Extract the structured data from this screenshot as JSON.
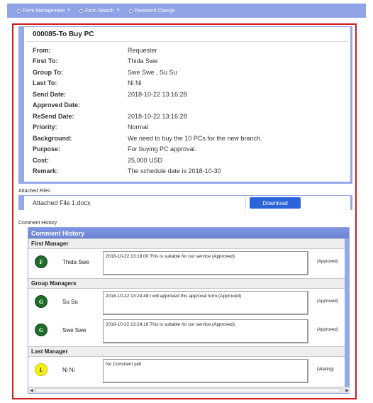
{
  "nav": {
    "items": [
      {
        "label": "Form Management",
        "has_menu": true,
        "icon": "bullet-icon"
      },
      {
        "label": "Form Search",
        "has_menu": true,
        "icon": "bullet-icon"
      },
      {
        "label": "Password Change",
        "has_menu": false,
        "icon": "bullet-icon"
      }
    ],
    "caret": "▼"
  },
  "form": {
    "title": "000085-To Buy PC",
    "fields": [
      {
        "label": "From:",
        "value": "Requester"
      },
      {
        "label": "First To:",
        "value": "Thida Swe"
      },
      {
        "label": "Group To:",
        "value": "Swe Swe , Su Su"
      },
      {
        "label": "Last To:",
        "value": "Ni Ni"
      },
      {
        "label": "Send Date:",
        "value": "2018-10-22 13:16:28"
      },
      {
        "label": "Approved Date:",
        "value": ""
      },
      {
        "label": "ReSend Date:",
        "value": "2018-10-22 13:16:28"
      },
      {
        "label": "Priority:",
        "value": "Normal"
      },
      {
        "label": "Background:",
        "value": "We need to buy the 10 PCs for the new branch."
      },
      {
        "label": "Purpose:",
        "value": "For buying PC approval."
      },
      {
        "label": "Cost:",
        "value": "25,000 USD"
      },
      {
        "label": "Remark:",
        "value": "The schedule date is 2018-10-30"
      }
    ]
  },
  "attachments": {
    "caption": "Attached Files",
    "file_name": "Attached File 1.docx",
    "download_label": "Download"
  },
  "history": {
    "caption": "Comment History",
    "header": "Comment History",
    "groups": [
      {
        "title": "First Manager",
        "entries": [
          {
            "initial": "F",
            "name": "Thida Swe",
            "comment": "2018-10-22 13:19:00:This is suitable for our service (Approved)",
            "status": "(Approved)",
            "avatar_color": "#1f6b2a",
            "avatar_text_color": "#ffffff"
          }
        ]
      },
      {
        "title": "Group Managers",
        "entries": [
          {
            "initial": "G",
            "name": "Su Su",
            "comment": "2018-10-22 13:24:48:I will approved this approval form.(Approved)",
            "status": "(Approved)",
            "avatar_color": "#1f6b2a",
            "avatar_text_color": "#ffffff"
          },
          {
            "initial": "G",
            "name": "Swe Swe",
            "comment": "2018-10-22 13:24:16:This is suitable for our service.(Approved)",
            "status": "(Approved)",
            "avatar_color": "#1f6b2a",
            "avatar_text_color": "#ffffff"
          }
        ]
      },
      {
        "title": "Last Manager",
        "entries": [
          {
            "initial": "L",
            "name": "Ni Ni",
            "comment": "No Comment yet!",
            "status": "(Waiting)",
            "avatar_color": "#f4ef10",
            "avatar_text_color": "#333333"
          }
        ]
      }
    ],
    "scroll_left": "◀",
    "scroll_right": "▶"
  },
  "colors": {
    "nav": "#8fa3e6",
    "frame": "#d11a1a",
    "accent": "#95a8e8",
    "button": "#2b63d9"
  }
}
